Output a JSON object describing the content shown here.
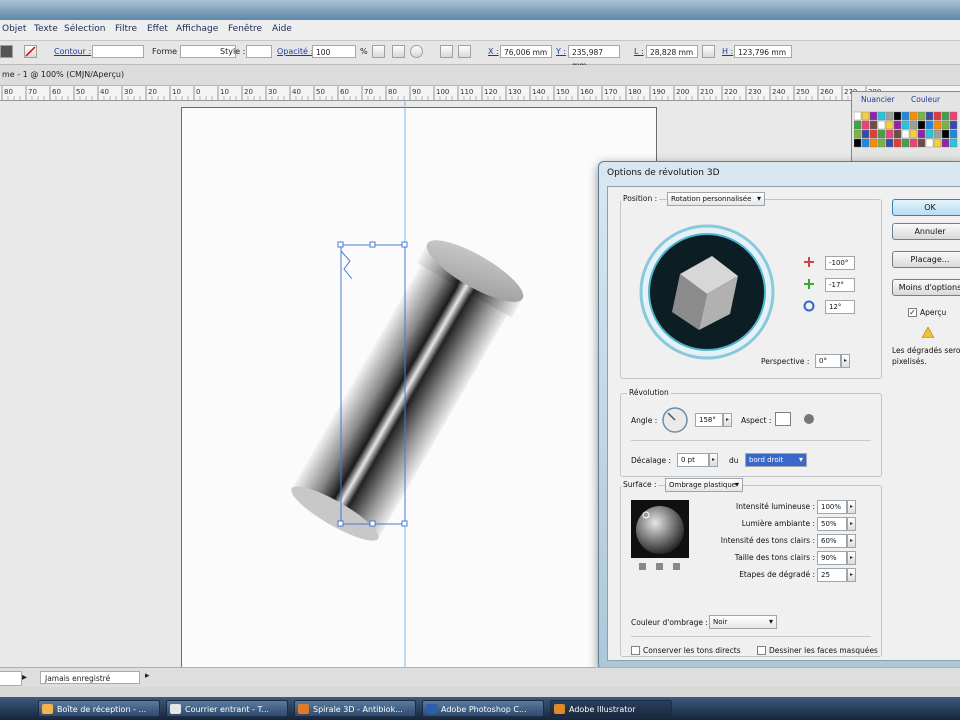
{
  "menu": {
    "items": [
      "Objet",
      "Texte",
      "Sélection",
      "Filtre",
      "Effet",
      "Affichage",
      "Fenêtre",
      "Aide"
    ]
  },
  "control_bar": {
    "contour_label": "Contour :",
    "forme_label": "Forme :",
    "style_label": "Style :",
    "opacite_label": "Opacité :",
    "opacite_value": "100",
    "percent": "%",
    "x_label": "X :",
    "x_value": "76,006 mm",
    "y_label": "Y :",
    "y_value": "235,987 mm",
    "l_label": "L :",
    "l_value": "28,828 mm",
    "h_label": "H :",
    "h_value": "123,796 mm"
  },
  "document": {
    "tab_title": "me - 1 @ 100% (CMJN/Aperçu)"
  },
  "ruler": {
    "ticks": [
      "80",
      "70",
      "60",
      "50",
      "40",
      "30",
      "20",
      "10",
      "0",
      "10",
      "20",
      "30",
      "40",
      "50",
      "60",
      "70",
      "80",
      "90",
      "100",
      "110",
      "120",
      "130",
      "140",
      "150",
      "160",
      "170",
      "180",
      "190",
      "200",
      "210",
      "220",
      "230",
      "240",
      "250",
      "260",
      "270",
      "280"
    ]
  },
  "status": {
    "zoom_value": "",
    "save_state": "Jamais enregistré"
  },
  "swatches_panel": {
    "tab1": "Nuancier",
    "tab2": "Couleur"
  },
  "dialog": {
    "title": "Options de révolution 3D",
    "position_label": "Position :",
    "position_value": "Rotation personnalisée",
    "rot_x": "-100°",
    "rot_y": "-17°",
    "rot_z": "12°",
    "perspective_label": "Perspective :",
    "perspective_value": "0°",
    "revolution_group": "Révolution",
    "angle_label": "Angle :",
    "angle_value": "158°",
    "aspect_label": "Aspect :",
    "decalage_label": "Décalage :",
    "decalage_value": "0 pt",
    "du_label": "du",
    "du_value": "bord droit",
    "surface_label": "Surface :",
    "surface_value": "Ombrage plastique",
    "light_rows": [
      {
        "label": "Intensité lumineuse :",
        "value": "100%"
      },
      {
        "label": "Lumière ambiante :",
        "value": "50%"
      },
      {
        "label": "Intensité des tons clairs :",
        "value": "60%"
      },
      {
        "label": "Taille des tons clairs :",
        "value": "90%"
      },
      {
        "label": "Etapes de dégradé :",
        "value": "25"
      }
    ],
    "couleur_label": "Couleur d'ombrage :",
    "couleur_value": "Noir",
    "conserver_label": "Conserver les tons directs",
    "dessiner_label": "Dessiner les faces masquées",
    "ok_label": "OK",
    "annuler_label": "Annuler",
    "placage_label": "Placage...",
    "moins_label": "Moins d'options",
    "apercu_label": "Aperçu",
    "warning_text_1": "Les dégradés seront",
    "warning_text_2": "pixelisés."
  },
  "taskbar": {
    "items": [
      {
        "label": "Boîte de réception - ..."
      },
      {
        "label": "Courrier entrant - T..."
      },
      {
        "label": "Spirale 3D - Antibiok..."
      },
      {
        "label": "Adobe Photoshop C..."
      },
      {
        "label": "Adobe Illustrator"
      }
    ]
  }
}
